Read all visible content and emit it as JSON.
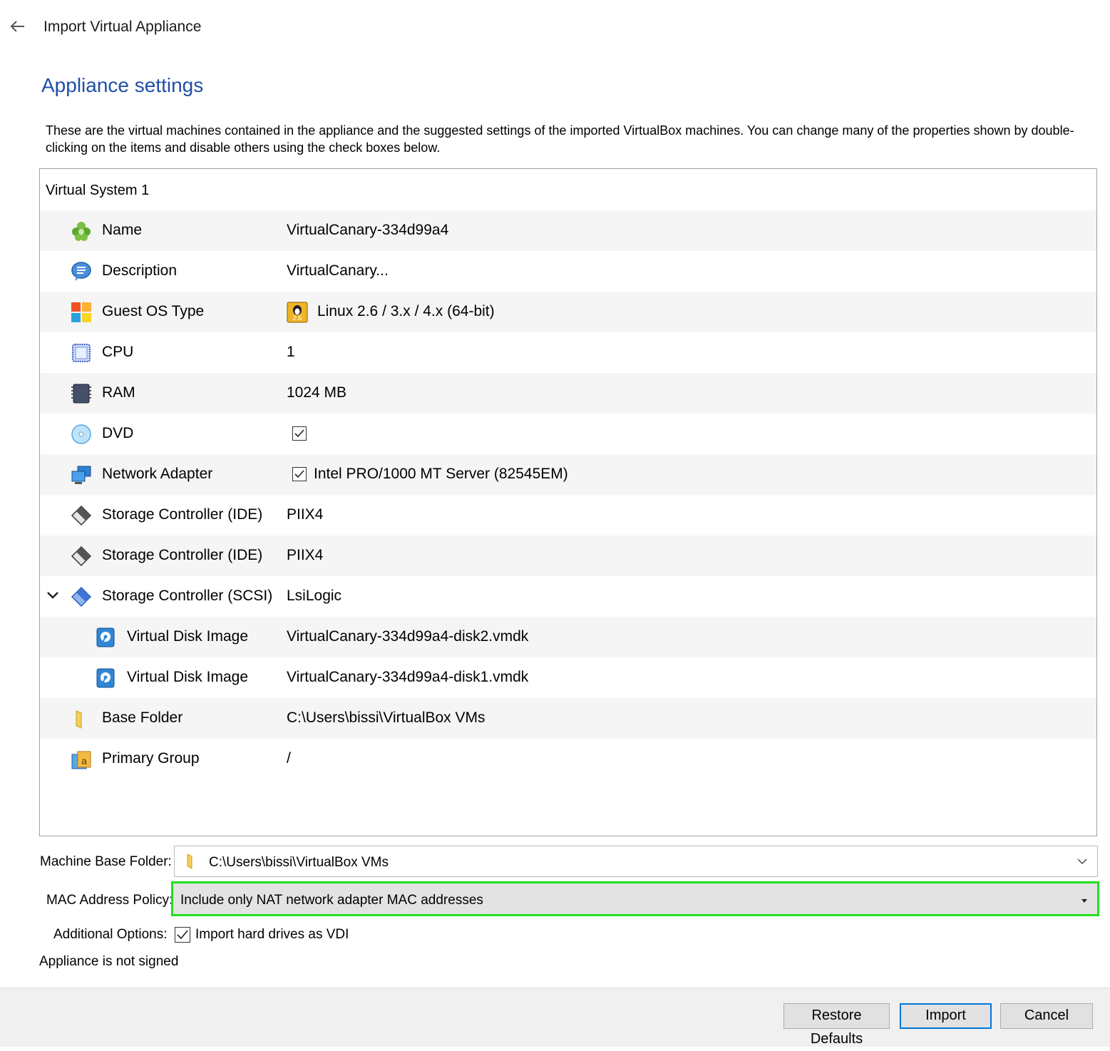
{
  "window": {
    "title": "Import Virtual Appliance"
  },
  "page": {
    "heading": "Appliance settings",
    "description": "These are the virtual machines contained in the appliance and the suggested settings of the imported VirtualBox machines. You can change many of the properties shown by double-clicking on the items and disable others using the check boxes below."
  },
  "tree": {
    "system_label": "Virtual System 1",
    "rows": [
      {
        "label": "Name",
        "value": "VirtualCanary-334d99a4",
        "icon": "name-icon"
      },
      {
        "label": "Description",
        "value": "VirtualCanary...",
        "icon": "description-icon"
      },
      {
        "label": "Guest OS Type",
        "value": "Linux 2.6 / 3.x / 4.x (64-bit)",
        "icon": "os-type-icon",
        "value_icon": "linux-icon",
        "value_icon_text": "2.6"
      },
      {
        "label": "CPU",
        "value": "1",
        "icon": "cpu-icon"
      },
      {
        "label": "RAM",
        "value": "1024 MB",
        "icon": "ram-icon"
      },
      {
        "label": "DVD",
        "value": "",
        "icon": "dvd-icon",
        "checked": true
      },
      {
        "label": "Network Adapter",
        "value": "Intel PRO/1000 MT Server (82545EM)",
        "icon": "network-adapter-icon",
        "checked": true
      },
      {
        "label": "Storage Controller (IDE)",
        "value": "PIIX4",
        "icon": "ide-controller-icon"
      },
      {
        "label": "Storage Controller (IDE)",
        "value": "PIIX4",
        "icon": "ide-controller-icon"
      },
      {
        "label": "Storage Controller (SCSI)",
        "value": "LsiLogic",
        "icon": "scsi-controller-icon",
        "expanded": true
      },
      {
        "label": "Virtual Disk Image",
        "value": "VirtualCanary-334d99a4-disk2.vmdk",
        "icon": "disk-image-icon"
      },
      {
        "label": "Virtual Disk Image",
        "value": "VirtualCanary-334d99a4-disk1.vmdk",
        "icon": "disk-image-icon"
      },
      {
        "label": "Base Folder",
        "value": "C:\\Users\\bissi\\VirtualBox VMs",
        "icon": "folder-icon"
      },
      {
        "label": "Primary Group",
        "value": "/",
        "icon": "group-icon"
      }
    ]
  },
  "form": {
    "machine_base_folder": {
      "label": "Machine Base Folder:",
      "value": "C:\\Users\\bissi\\VirtualBox VMs"
    },
    "mac_policy": {
      "label": "MAC Address Policy:",
      "value": "Include only NAT network adapter MAC addresses"
    },
    "additional": {
      "label": "Additional Options:",
      "checkbox_label": "Import hard drives as VDI",
      "checked": true
    },
    "signature_status": "Appliance is not signed"
  },
  "buttons": {
    "restore": "Restore Defaults",
    "import": "Import",
    "cancel": "Cancel"
  },
  "colors": {
    "accent": "#1e4fa6",
    "highlight_border": "#22e01e",
    "focus_border": "#0078d7"
  }
}
